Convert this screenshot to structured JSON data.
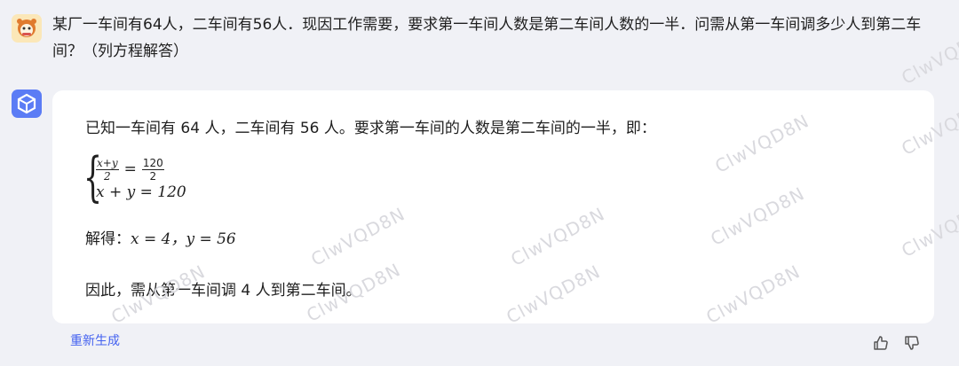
{
  "user": {
    "avatar": "user-avatar",
    "message": "某厂一车间有64人，二车间有56人．现因工作需要，要求第一车间人数是第二车间人数的一半．问需从第一车间调多少人到第二车间？（列方程解答）"
  },
  "assistant": {
    "avatar": "assistant-avatar",
    "line1": "已知一车间有 64 人，二车间有 56 人。要求第一车间的人数是第二车间的一半，即：",
    "equations": {
      "frac1_num": "x+y",
      "frac1_den": "2",
      "equals": "=",
      "frac2_num": "120",
      "frac2_den": "2",
      "row2": "x + y = 120"
    },
    "solution_prefix": "解得：",
    "solution": "x = 4，y = 56",
    "conclusion": "因此，需从第一车间调 4 人到第二车间。"
  },
  "actions": {
    "regenerate": "重新生成",
    "like_icon": "thumbs-up-icon",
    "dislike_icon": "thumbs-down-icon"
  },
  "watermark": "ClwVQD8N",
  "colors": {
    "background": "#f0f1f6",
    "card": "#ffffff",
    "accent": "#4462f0",
    "user_avatar_bg": "#fbe7b8",
    "bot_avatar_bg": "#5b7cf5"
  }
}
